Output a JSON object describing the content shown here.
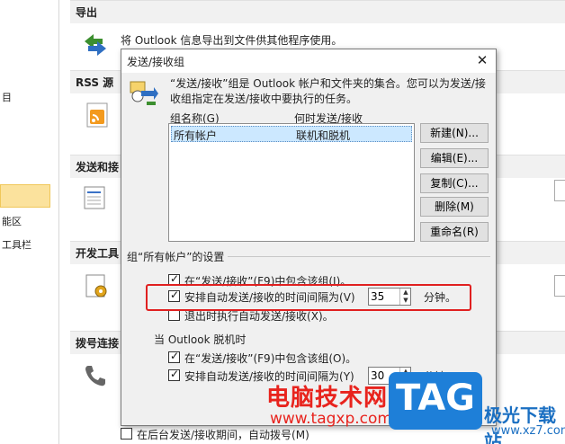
{
  "sidebar": {
    "items": [
      {
        "label": "目"
      },
      {
        "label": "能区"
      },
      {
        "label": "工具栏"
      }
    ]
  },
  "sections": {
    "export": "导出",
    "rss": "RSS 源",
    "send_receive": "发送和接",
    "developer": "开发工具",
    "dialup": "拨号连接"
  },
  "export_text": "将 Outlook 信息导出到文件供其他程序使用。",
  "dialog": {
    "title": "发送/接收组",
    "close": "✕",
    "intro": "“发送/接收”组是 Outlook 帐户和文件夹的集合。您可以为发送/接收组指定在发送/接收中要执行的任务。",
    "col_name": "组名称(G)",
    "col_when": "何时发送/接收",
    "row_name": "所有帐户",
    "row_when": "联机和脱机",
    "buttons": {
      "new": "新建(N)...",
      "edit": "编辑(E)...",
      "copy": "复制(C)...",
      "delete": "删除(M)",
      "rename": "重命名(R)"
    },
    "group_settings": "组“所有帐户”的设置",
    "online": {
      "include": "在“发送/接收”(F9)中包含该组(I)。",
      "schedule": "安排自动发送/接收的时间间隔为(V)",
      "interval": "35",
      "unit": "分钟。",
      "on_exit": "退出时执行自动发送/接收(X)。"
    },
    "offline_label": "当 Outlook 脱机时",
    "offline": {
      "include": "在“发送/接收”(F9)中包含该组(O)。",
      "schedule": "安排自动发送/接收的时间间隔为(Y)",
      "interval": "30",
      "unit": "分钟。"
    }
  },
  "bottom_option": "在后台发送/接收期间，自动拨号(M)",
  "watermark": {
    "cn": "电脑技术网",
    "url": "www.tagxp.com",
    "tag": "TAG",
    "site": "极光下载站",
    "site_url": "www.xz7.com"
  },
  "colors": {
    "highlight_box": "#e02020",
    "sidebar_selected": "#fbe29d",
    "list_selection": "#cce8ff"
  }
}
